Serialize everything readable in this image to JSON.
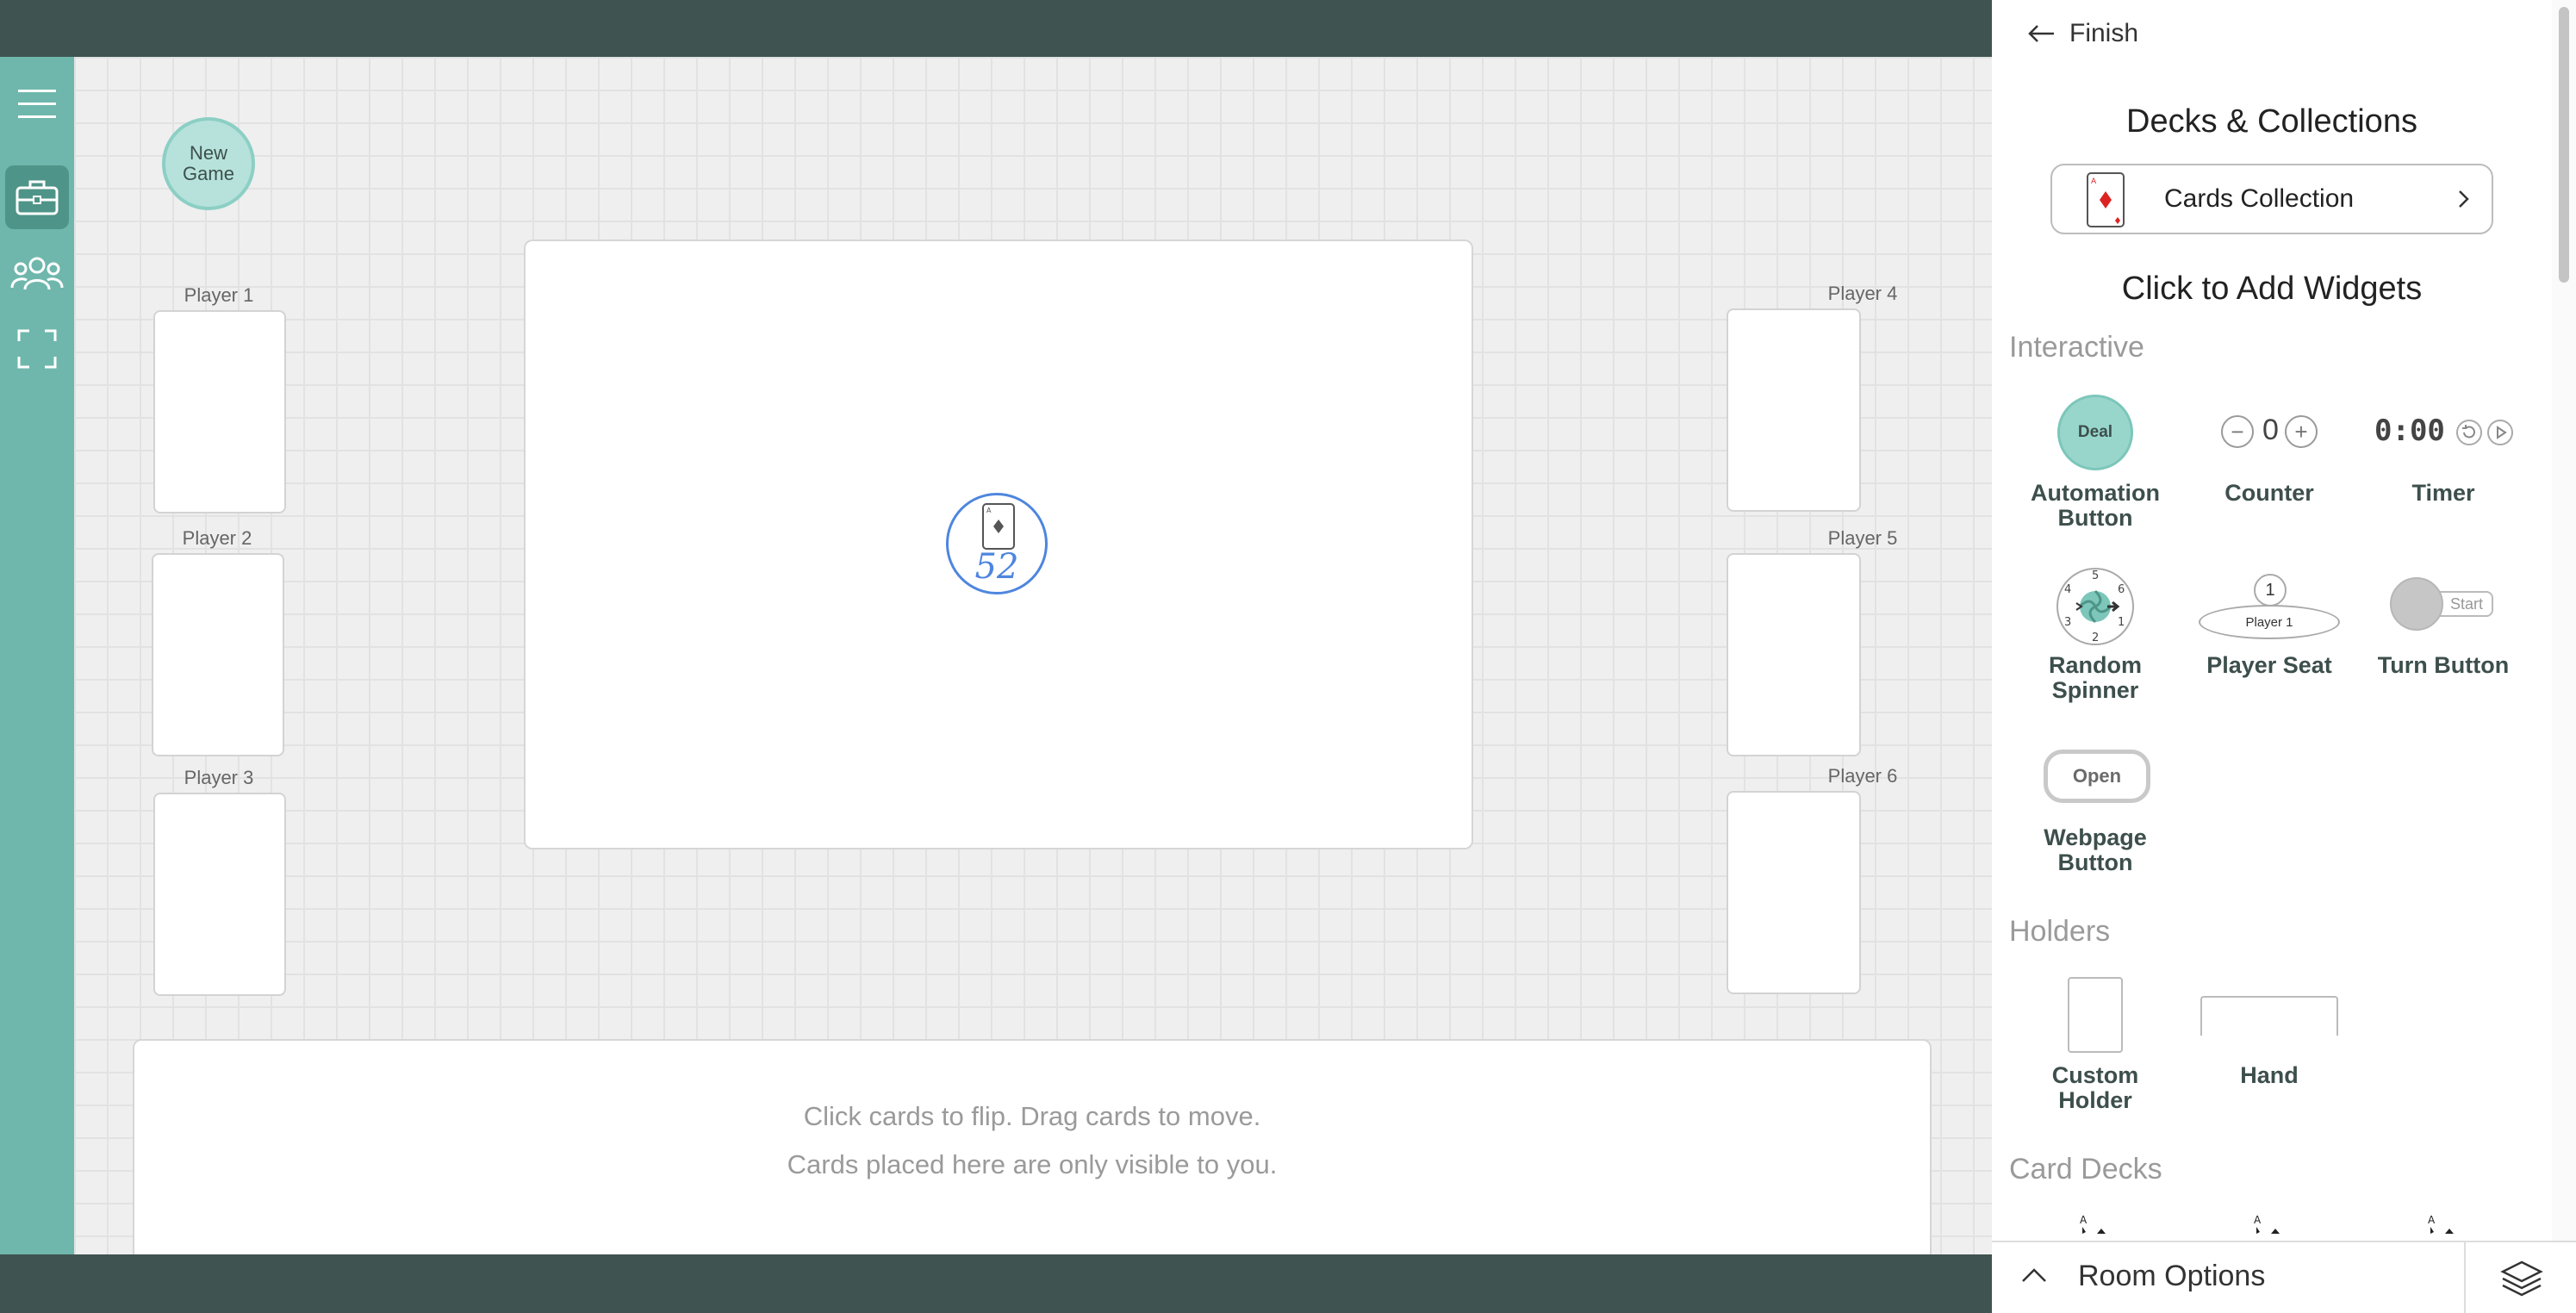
{
  "canvas": {
    "new_game_label": "New\nGame",
    "players": [
      "Player 1",
      "Player 2",
      "Player 3",
      "Player 4",
      "Player 5",
      "Player 6"
    ],
    "deck_count": "52",
    "hand_text_line1": "Click cards to flip.   Drag cards to move.",
    "hand_text_line2": "Cards placed here are only visible to you."
  },
  "sidebar": {
    "icons": [
      "menu-icon",
      "toolbox-icon",
      "people-icon",
      "fullscreen-icon"
    ]
  },
  "panel": {
    "finish_label": "Finish",
    "decks_title": "Decks & Collections",
    "collection_label": "Cards Collection",
    "widgets_title": "Click to Add Widgets",
    "sections": {
      "interactive": "Interactive",
      "holders": "Holders",
      "card_decks": "Card Decks"
    },
    "widgets": {
      "automation": {
        "label": "Automation\nButton",
        "button_text": "Deal"
      },
      "counter": {
        "label": "Counter",
        "value": "0",
        "minus": "−",
        "plus": "+"
      },
      "timer": {
        "label": "Timer",
        "value": "0:00"
      },
      "spinner": {
        "label": "Random\nSpinner",
        "numbers": [
          "5",
          "6",
          "1",
          "2",
          "3",
          "4"
        ]
      },
      "player_seat": {
        "label": "Player Seat",
        "seat_number": "1",
        "seat_name": "Player 1"
      },
      "turn_button": {
        "label": "Turn Button",
        "start_text": "Start"
      },
      "webpage": {
        "label": "Webpage\nButton",
        "button_text": "Open"
      },
      "custom_holder": {
        "label": "Custom\nHolder"
      },
      "hand": {
        "label": "Hand"
      }
    },
    "card_deck_letter": "A"
  },
  "room_options": {
    "label": "Room Options"
  },
  "colors": {
    "rail": "#6fb7ac",
    "dark_bar": "#3f5350",
    "accent_teal": "#98d6cc",
    "deck_blue": "#4e86de"
  }
}
